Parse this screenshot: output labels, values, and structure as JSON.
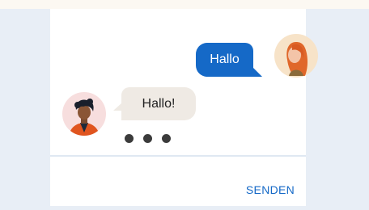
{
  "messages": {
    "outgoing_text": "Hallo",
    "incoming_text": "Hallo!"
  },
  "composer": {
    "send_label": "SENDEN"
  },
  "icons": {
    "sender_avatar": "woman-red-hair-avatar",
    "receiver_avatar": "man-dark-hair-avatar",
    "typing_indicator": "typing-dots-icon"
  },
  "colors": {
    "accent": "#1569c7",
    "incoming_bubble": "#efeae4",
    "background": "#e8eef6",
    "card": "#ffffff"
  }
}
